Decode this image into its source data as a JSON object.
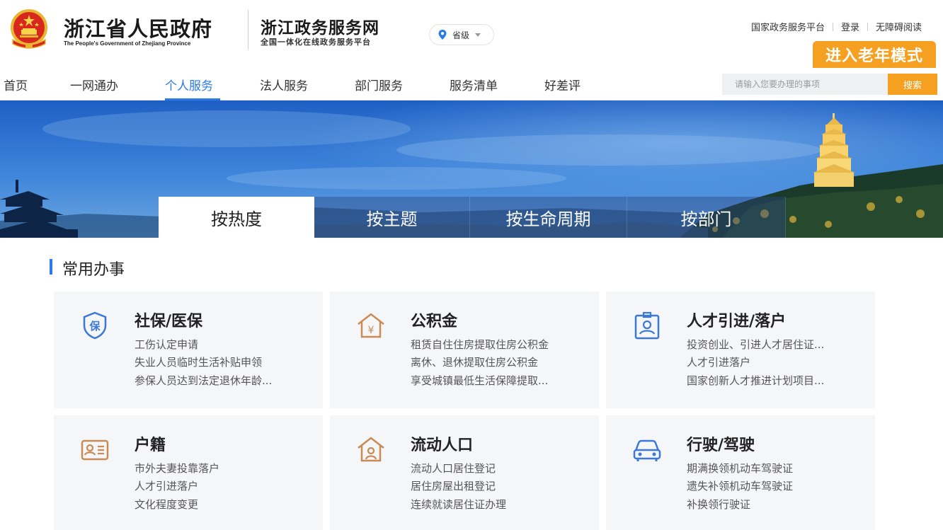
{
  "header": {
    "gov_title": "浙江省人民政府",
    "gov_subtitle": "The People's Government of Zhejiang Province",
    "site_title": "浙江政务服务网",
    "site_subtitle": "全国一体化在线政务服务平台",
    "region": "省级",
    "links": [
      "国家政务服务平台",
      "登录",
      "无障碍阅读"
    ],
    "elder_mode": "进入老年模式"
  },
  "nav": {
    "items": [
      "首页",
      "一网通办",
      "个人服务",
      "法人服务",
      "部门服务",
      "服务清单",
      "好差评"
    ],
    "active": "个人服务",
    "search_placeholder": "请输入您要办理的事项",
    "search_button": "搜索"
  },
  "banner": {
    "tabs": [
      "按热度",
      "按主题",
      "按生命周期",
      "按部门"
    ],
    "active_tab": "按热度"
  },
  "section": {
    "title": "常用办事",
    "cards": [
      {
        "title": "社保/医保",
        "icon": "shield-bao-icon",
        "links": [
          "工伤认定申请",
          "失业人员临时生活补贴申领",
          "参保人员达到法定退休年龄..."
        ]
      },
      {
        "title": "公积金",
        "icon": "house-yuan-icon",
        "links": [
          "租赁自住住房提取住房公积金",
          "离休、退休提取住房公积金",
          "享受城镇最低生活保障提取..."
        ]
      },
      {
        "title": "人才引进/落户",
        "icon": "id-badge-icon",
        "links": [
          "投资创业、引进人才居住证...",
          "人才引进落户",
          "国家创新人才推进计划项目..."
        ]
      },
      {
        "title": "户籍",
        "icon": "id-card-icon",
        "links": [
          "市外夫妻投靠落户",
          "人才引进落户",
          "文化程度变更"
        ]
      },
      {
        "title": "流动人口",
        "icon": "house-person-icon",
        "links": [
          "流动人口居住登记",
          "居住房屋出租登记",
          "连续就读居住证办理"
        ]
      },
      {
        "title": "行驶/驾驶",
        "icon": "car-icon",
        "links": [
          "期满换领机动车驾驶证",
          "遗失补领机动车驾驶证",
          "补换领行驶证"
        ]
      }
    ]
  },
  "colors": {
    "accent_blue": "#2a7be8",
    "accent_orange": "#f5a020",
    "icon_orange": "#c98a55",
    "icon_blue": "#3c78d8"
  }
}
